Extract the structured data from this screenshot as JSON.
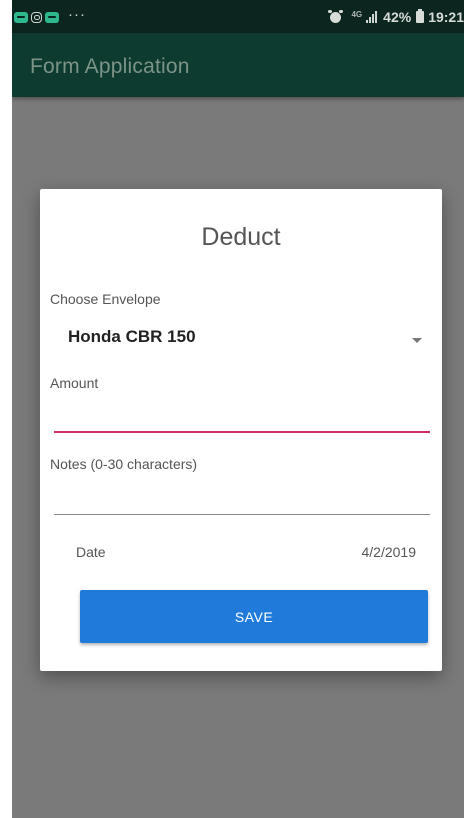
{
  "colors": {
    "status_bar": "#0c251f",
    "app_bar": "#0e3b30",
    "scrim": "#7a7a7a",
    "accent": "#d22c64",
    "primary_button": "#1f7ad9"
  },
  "status_bar": {
    "notification_icons": [
      "message-icon",
      "instagram-icon",
      "message-icon"
    ],
    "more_indicator": "···",
    "network_type": "4G",
    "battery_percent": "42%",
    "time": "19:21"
  },
  "app_bar": {
    "title": "Form Application"
  },
  "dialog": {
    "title": "Deduct",
    "envelope": {
      "label": "Choose Envelope",
      "selected": "Honda CBR 150"
    },
    "amount": {
      "label": "Amount",
      "value": ""
    },
    "notes": {
      "label": "Notes (0-30 characters)",
      "value": ""
    },
    "date": {
      "label": "Date",
      "value": "4/2/2019"
    },
    "save_label": "SAVE"
  }
}
